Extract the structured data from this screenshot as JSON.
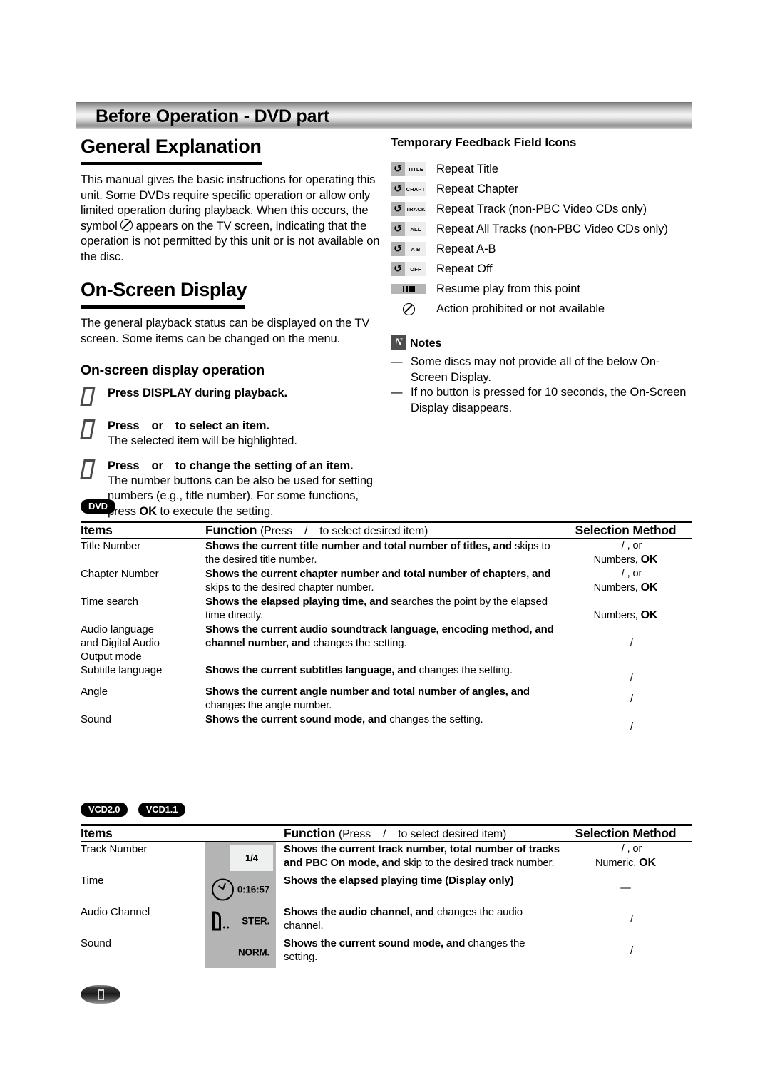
{
  "header": {
    "title": "Before Operation - DVD part"
  },
  "left": {
    "general": {
      "heading": "General Explanation",
      "paragraph": "This manual gives the basic instructions for operating this unit. Some DVDs require specific operation or allow only limited operation during playback. When this occurs, the symbol",
      "paragraph_tail": "appears on the TV screen, indicating that the operation is not permitted by this unit or is not available on the disc."
    },
    "osd": {
      "heading": "On-Screen Display",
      "paragraph": "The general playback status can be displayed on the TV screen. Some items can be changed on the menu."
    },
    "operation": {
      "heading": "On-screen display operation",
      "steps": [
        {
          "title": "Press DISPLAY during playback.",
          "body": ""
        },
        {
          "title_a": "Press",
          "title_b": "or",
          "title_c": "to select an item.",
          "body": "The selected item will be highlighted."
        },
        {
          "title_a": "Press",
          "title_b": "or",
          "title_c": "to change the setting of an item.",
          "body": "The number buttons can be also be used for setting numbers (e.g., title number). For some functions, press OK to execute the setting."
        }
      ]
    }
  },
  "right": {
    "feedback": {
      "heading": "Temporary Feedback Field Icons",
      "items": [
        {
          "icon": "repeat-title-icon",
          "glyph": "repeat-symbol",
          "tag": "TITLE",
          "label": "Repeat Title"
        },
        {
          "icon": "repeat-chapter-icon",
          "glyph": "repeat-symbol",
          "tag": "CHAPT",
          "label": "Repeat Chapter"
        },
        {
          "icon": "repeat-track-icon",
          "glyph": "repeat-symbol",
          "tag": "TRACK",
          "label": "Repeat Track (non-PBC Video CDs only)"
        },
        {
          "icon": "repeat-all-icon",
          "glyph": "repeat-symbol",
          "tag": "ALL",
          "label": "Repeat All Tracks (non-PBC Video CDs only)"
        },
        {
          "icon": "repeat-ab-icon",
          "glyph": "repeat-symbol",
          "tag": "A  B",
          "label": "Repeat A-B"
        },
        {
          "icon": "repeat-off-icon",
          "glyph": "repeat-symbol",
          "tag": "OFF",
          "label": "Repeat Off"
        }
      ],
      "resume": {
        "icon": "resume-play-icon",
        "label": "Resume play from this point"
      },
      "prohibited": {
        "icon": "action-prohibited-icon",
        "label": "Action prohibited or not available"
      }
    },
    "notes": {
      "badge": "N",
      "title": "Notes",
      "items": [
        "Some discs may not provide all of the below On-Screen Display.",
        "If no button is pressed for 10 seconds, the On-Screen Display disappears."
      ],
      "dash": "—"
    }
  },
  "dvd_table": {
    "badges": [
      "DVD"
    ],
    "headers": {
      "items": "Items",
      "function_bold": "Function",
      "function_rest_a": "(Press",
      "function_slash": "/",
      "function_rest_b": "to select desired item)",
      "selection": "Selection Method"
    },
    "rows": [
      {
        "item": "Title Number",
        "fn_bold": "Shows the current title number and total number of titles, and",
        "fn_norm": "skips to the desired title number.",
        "sel_line1": "/   , or",
        "sel_line2_norm": "Numbers, ",
        "sel_line2_bold": "OK"
      },
      {
        "item": "Chapter Number",
        "fn_bold": "Shows the current chapter number and total number of chapters, and",
        "fn_norm": "skips to the desired chapter number.",
        "sel_line1": "/   , or",
        "sel_line2_norm": "Numbers, ",
        "sel_line2_bold": "OK"
      },
      {
        "item": "Time search",
        "fn_bold": "Shows the elapsed playing time, and",
        "fn_norm": "searches the point by the elapsed time directly.",
        "sel_line1": "",
        "sel_line2_norm": "Numbers, ",
        "sel_line2_bold": "OK"
      },
      {
        "item": "Audio language and Digital Audio Output mode",
        "fn_bold": "Shows the current audio soundtrack language, encoding method, and channel number, and",
        "fn_norm": "changes the setting.",
        "sel_line1": "/",
        "sel_line2_norm": "",
        "sel_line2_bold": ""
      },
      {
        "item": "Subtitle language",
        "fn_bold": "Shows the current subtitles language, and",
        "fn_norm": "changes the setting.",
        "sel_line1": "/",
        "sel_line2_norm": "",
        "sel_line2_bold": ""
      },
      {
        "item": "Angle",
        "fn_bold": "Shows the current angle number and total number of angles, and",
        "fn_norm": "changes the angle number.",
        "sel_line1": "/",
        "sel_line2_norm": "",
        "sel_line2_bold": ""
      },
      {
        "item": "Sound",
        "fn_bold": "Shows the current sound mode, and",
        "fn_norm": "changes the setting.",
        "sel_line1": "/",
        "sel_line2_norm": "",
        "sel_line2_bold": ""
      }
    ]
  },
  "vcd_table": {
    "badges": [
      "VCD2.0",
      "VCD1.1"
    ],
    "headers": {
      "items": "Items",
      "function_bold": "Function",
      "function_rest_a": "(Press",
      "function_slash": "/",
      "function_rest_b": "to select desired item)",
      "selection": "Selection Method"
    },
    "rows": [
      {
        "item": "Track Number",
        "osd_kind": "track",
        "osd_value": "1/4",
        "fn_bold": "Shows the current track number, total number of tracks and PBC On mode, and",
        "fn_norm": "skip to the desired track number.",
        "sel_line1": "/   , or",
        "sel_line2_norm": "Numeric, ",
        "sel_line2_bold": "OK"
      },
      {
        "item": "Time",
        "osd_kind": "clock",
        "osd_value": "0:16:57",
        "fn_bold": "Shows the elapsed playing time (Display only)",
        "fn_norm": "",
        "sel_line1": "—",
        "sel_line2_norm": "",
        "sel_line2_bold": ""
      },
      {
        "item": "Audio Channel",
        "osd_kind": "speaker",
        "osd_value": "STER.",
        "fn_bold": "Shows the audio channel, and",
        "fn_norm": "changes the audio channel.",
        "sel_line1": "/",
        "sel_line2_norm": "",
        "sel_line2_bold": ""
      },
      {
        "item": "Sound",
        "osd_kind": "plain",
        "osd_value": "NORM.",
        "fn_bold": "Shows the current sound mode, and",
        "fn_norm": "changes the setting.",
        "sel_line1": "/",
        "sel_line2_norm": "",
        "sel_line2_bold": ""
      }
    ]
  },
  "footer": {
    "page_badge": "page-number-badge"
  }
}
